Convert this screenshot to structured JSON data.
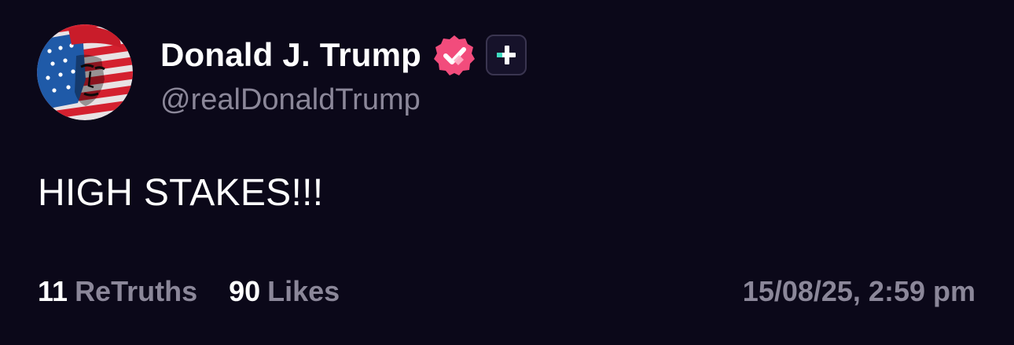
{
  "post": {
    "author": {
      "display_name": "Donald J. Trump",
      "handle": "@realDonaldTrump",
      "avatar_icon": "american-flag-portrait",
      "verified_icon": "verified-check-badge",
      "verified_color": "#f24c7c",
      "plus_badge_icon": "truth-plus-badge"
    },
    "text": "HIGH STAKES!!!",
    "stats": {
      "retruths_count": "11",
      "retruths_label": "ReTruths",
      "likes_count": "90",
      "likes_label": "Likes"
    },
    "timestamp": "15/08/25, 2:59 pm"
  },
  "colors": {
    "background": "#0b0819",
    "primary_text": "#ffffff",
    "secondary_text": "#8b8799",
    "accent_teal": "#3ddbc0",
    "accent_pink": "#f24c7c"
  }
}
